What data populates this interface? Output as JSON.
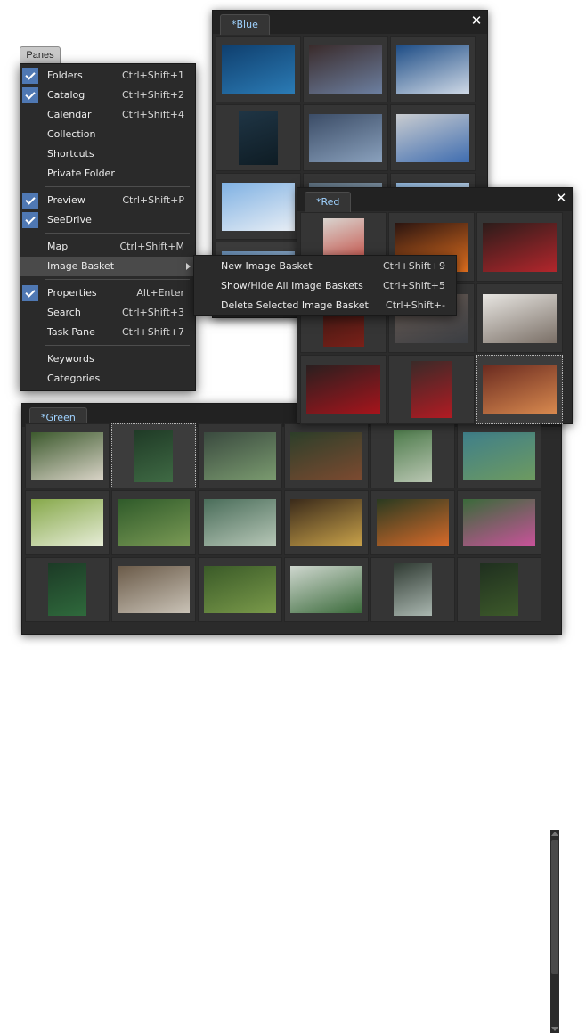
{
  "panes_button": "Panes",
  "menu": {
    "items": [
      {
        "label": "Folders",
        "shortcut": "Ctrl+Shift+1",
        "checked": true
      },
      {
        "label": "Catalog",
        "shortcut": "Ctrl+Shift+2",
        "checked": true
      },
      {
        "label": "Calendar",
        "shortcut": "Ctrl+Shift+4",
        "checked": false
      },
      {
        "label": "Collection",
        "shortcut": "",
        "checked": false
      },
      {
        "label": "Shortcuts",
        "shortcut": "",
        "checked": false
      },
      {
        "label": "Private Folder",
        "shortcut": "",
        "checked": false
      },
      {
        "label": "Preview",
        "shortcut": "Ctrl+Shift+P",
        "checked": true
      },
      {
        "label": "SeeDrive",
        "shortcut": "",
        "checked": true
      },
      {
        "label": "Map",
        "shortcut": "Ctrl+Shift+M",
        "checked": false
      },
      {
        "label": "Image Basket",
        "shortcut": "",
        "checked": false,
        "submenu": true
      },
      {
        "label": "Properties",
        "shortcut": "Alt+Enter",
        "checked": true
      },
      {
        "label": "Search",
        "shortcut": "Ctrl+Shift+3",
        "checked": false
      },
      {
        "label": "Task Pane",
        "shortcut": "Ctrl+Shift+7",
        "checked": false
      },
      {
        "label": "Keywords",
        "shortcut": "",
        "checked": false
      },
      {
        "label": "Categories",
        "shortcut": "",
        "checked": false
      }
    ]
  },
  "submenu": {
    "items": [
      {
        "label": "New Image Basket",
        "shortcut": "Ctrl+Shift+9"
      },
      {
        "label": "Show/Hide All Image Baskets",
        "shortcut": "Ctrl+Shift+5"
      },
      {
        "label": "Delete Selected Image Basket",
        "shortcut": "Ctrl+Shift+-"
      }
    ]
  },
  "baskets": {
    "blue": {
      "title": "*Blue",
      "close_icon": "close-icon"
    },
    "red": {
      "title": "*Red",
      "close_icon": "close-icon"
    },
    "green": {
      "title": "*Green"
    }
  },
  "thumb_colors": {
    "blue": [
      [
        "#0f3f6e",
        "#2b7bb5"
      ],
      [
        "#3a2b2b",
        "#6c7fa0"
      ],
      [
        "#1e4d86",
        "#cfd9e6"
      ],
      [
        "#1f3545",
        "#0e1c24"
      ],
      [
        "#3b4c66",
        "#8aa1bd"
      ],
      [
        "#c9ccd0",
        "#3f6db0"
      ],
      [
        "#7fb1e3",
        "#e8eef5"
      ],
      [
        "#5d7080",
        "#a9c0d4"
      ],
      [
        "#8fb6dd",
        "#e3ecf4"
      ],
      [
        "#6a90b8",
        "#b4cbe2"
      ]
    ],
    "red": [
      [
        "#d9d4cf",
        "#c1342a"
      ],
      [
        "#2a1410",
        "#e2701f"
      ],
      [
        "#2b1c1a",
        "#b3262c"
      ],
      [
        "#2a1613",
        "#7a2018"
      ],
      [
        "#6b5d55",
        "#3a3d42"
      ],
      [
        "#e8e6e2",
        "#7a6f66"
      ],
      [
        "#2a1f1f",
        "#a8141c"
      ],
      [
        "#3a2a28",
        "#b21b23"
      ],
      [
        "#6b2b20",
        "#d98a4f"
      ]
    ],
    "green": [
      [
        "#3d5a2e",
        "#d7d2c5"
      ],
      [
        "#1f3a26",
        "#3f6a44"
      ],
      [
        "#3a4a3f",
        "#7a9a6f"
      ],
      [
        "#2d3f2a",
        "#7c4a30"
      ],
      [
        "#4c7a4a",
        "#b9c6b2"
      ],
      [
        "#3f7f8a",
        "#6d9a60"
      ],
      [
        "#86a84a",
        "#e7edd8"
      ],
      [
        "#2f5a2a",
        "#7a9a55"
      ],
      [
        "#4a6d5a",
        "#b7c7b7"
      ],
      [
        "#3a2a1a",
        "#c9a24a"
      ],
      [
        "#2a3a20",
        "#d86a2a"
      ],
      [
        "#3a6a3a",
        "#c9529a"
      ],
      [
        "#1c3a26",
        "#2f6a3c"
      ],
      [
        "#6a5a48",
        "#c9c2b6"
      ],
      [
        "#3a5a28",
        "#7a9a4a"
      ],
      [
        "#cfd7cf",
        "#3a6a3a"
      ],
      [
        "#2f3a32",
        "#aab7b0"
      ],
      [
        "#1f2f1f",
        "#3d5a2a"
      ]
    ]
  }
}
